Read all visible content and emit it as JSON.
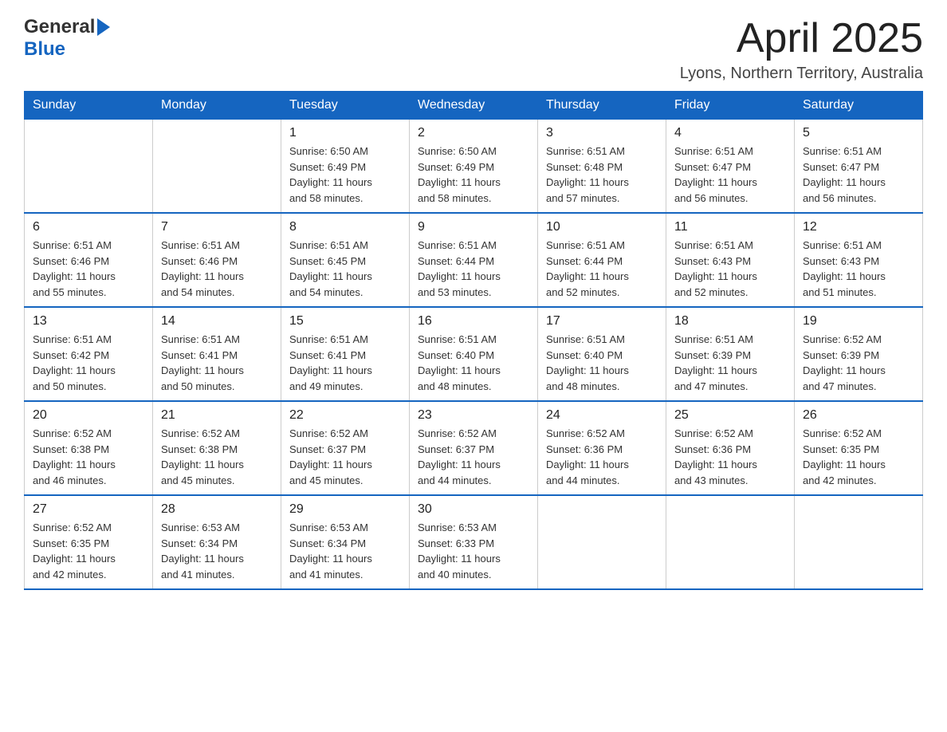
{
  "header": {
    "logo_general": "General",
    "logo_blue": "Blue",
    "month_title": "April 2025",
    "location": "Lyons, Northern Territory, Australia"
  },
  "weekdays": [
    "Sunday",
    "Monday",
    "Tuesday",
    "Wednesday",
    "Thursday",
    "Friday",
    "Saturday"
  ],
  "weeks": [
    [
      {
        "day": "",
        "info": ""
      },
      {
        "day": "",
        "info": ""
      },
      {
        "day": "1",
        "info": "Sunrise: 6:50 AM\nSunset: 6:49 PM\nDaylight: 11 hours\nand 58 minutes."
      },
      {
        "day": "2",
        "info": "Sunrise: 6:50 AM\nSunset: 6:49 PM\nDaylight: 11 hours\nand 58 minutes."
      },
      {
        "day": "3",
        "info": "Sunrise: 6:51 AM\nSunset: 6:48 PM\nDaylight: 11 hours\nand 57 minutes."
      },
      {
        "day": "4",
        "info": "Sunrise: 6:51 AM\nSunset: 6:47 PM\nDaylight: 11 hours\nand 56 minutes."
      },
      {
        "day": "5",
        "info": "Sunrise: 6:51 AM\nSunset: 6:47 PM\nDaylight: 11 hours\nand 56 minutes."
      }
    ],
    [
      {
        "day": "6",
        "info": "Sunrise: 6:51 AM\nSunset: 6:46 PM\nDaylight: 11 hours\nand 55 minutes."
      },
      {
        "day": "7",
        "info": "Sunrise: 6:51 AM\nSunset: 6:46 PM\nDaylight: 11 hours\nand 54 minutes."
      },
      {
        "day": "8",
        "info": "Sunrise: 6:51 AM\nSunset: 6:45 PM\nDaylight: 11 hours\nand 54 minutes."
      },
      {
        "day": "9",
        "info": "Sunrise: 6:51 AM\nSunset: 6:44 PM\nDaylight: 11 hours\nand 53 minutes."
      },
      {
        "day": "10",
        "info": "Sunrise: 6:51 AM\nSunset: 6:44 PM\nDaylight: 11 hours\nand 52 minutes."
      },
      {
        "day": "11",
        "info": "Sunrise: 6:51 AM\nSunset: 6:43 PM\nDaylight: 11 hours\nand 52 minutes."
      },
      {
        "day": "12",
        "info": "Sunrise: 6:51 AM\nSunset: 6:43 PM\nDaylight: 11 hours\nand 51 minutes."
      }
    ],
    [
      {
        "day": "13",
        "info": "Sunrise: 6:51 AM\nSunset: 6:42 PM\nDaylight: 11 hours\nand 50 minutes."
      },
      {
        "day": "14",
        "info": "Sunrise: 6:51 AM\nSunset: 6:41 PM\nDaylight: 11 hours\nand 50 minutes."
      },
      {
        "day": "15",
        "info": "Sunrise: 6:51 AM\nSunset: 6:41 PM\nDaylight: 11 hours\nand 49 minutes."
      },
      {
        "day": "16",
        "info": "Sunrise: 6:51 AM\nSunset: 6:40 PM\nDaylight: 11 hours\nand 48 minutes."
      },
      {
        "day": "17",
        "info": "Sunrise: 6:51 AM\nSunset: 6:40 PM\nDaylight: 11 hours\nand 48 minutes."
      },
      {
        "day": "18",
        "info": "Sunrise: 6:51 AM\nSunset: 6:39 PM\nDaylight: 11 hours\nand 47 minutes."
      },
      {
        "day": "19",
        "info": "Sunrise: 6:52 AM\nSunset: 6:39 PM\nDaylight: 11 hours\nand 47 minutes."
      }
    ],
    [
      {
        "day": "20",
        "info": "Sunrise: 6:52 AM\nSunset: 6:38 PM\nDaylight: 11 hours\nand 46 minutes."
      },
      {
        "day": "21",
        "info": "Sunrise: 6:52 AM\nSunset: 6:38 PM\nDaylight: 11 hours\nand 45 minutes."
      },
      {
        "day": "22",
        "info": "Sunrise: 6:52 AM\nSunset: 6:37 PM\nDaylight: 11 hours\nand 45 minutes."
      },
      {
        "day": "23",
        "info": "Sunrise: 6:52 AM\nSunset: 6:37 PM\nDaylight: 11 hours\nand 44 minutes."
      },
      {
        "day": "24",
        "info": "Sunrise: 6:52 AM\nSunset: 6:36 PM\nDaylight: 11 hours\nand 44 minutes."
      },
      {
        "day": "25",
        "info": "Sunrise: 6:52 AM\nSunset: 6:36 PM\nDaylight: 11 hours\nand 43 minutes."
      },
      {
        "day": "26",
        "info": "Sunrise: 6:52 AM\nSunset: 6:35 PM\nDaylight: 11 hours\nand 42 minutes."
      }
    ],
    [
      {
        "day": "27",
        "info": "Sunrise: 6:52 AM\nSunset: 6:35 PM\nDaylight: 11 hours\nand 42 minutes."
      },
      {
        "day": "28",
        "info": "Sunrise: 6:53 AM\nSunset: 6:34 PM\nDaylight: 11 hours\nand 41 minutes."
      },
      {
        "day": "29",
        "info": "Sunrise: 6:53 AM\nSunset: 6:34 PM\nDaylight: 11 hours\nand 41 minutes."
      },
      {
        "day": "30",
        "info": "Sunrise: 6:53 AM\nSunset: 6:33 PM\nDaylight: 11 hours\nand 40 minutes."
      },
      {
        "day": "",
        "info": ""
      },
      {
        "day": "",
        "info": ""
      },
      {
        "day": "",
        "info": ""
      }
    ]
  ]
}
